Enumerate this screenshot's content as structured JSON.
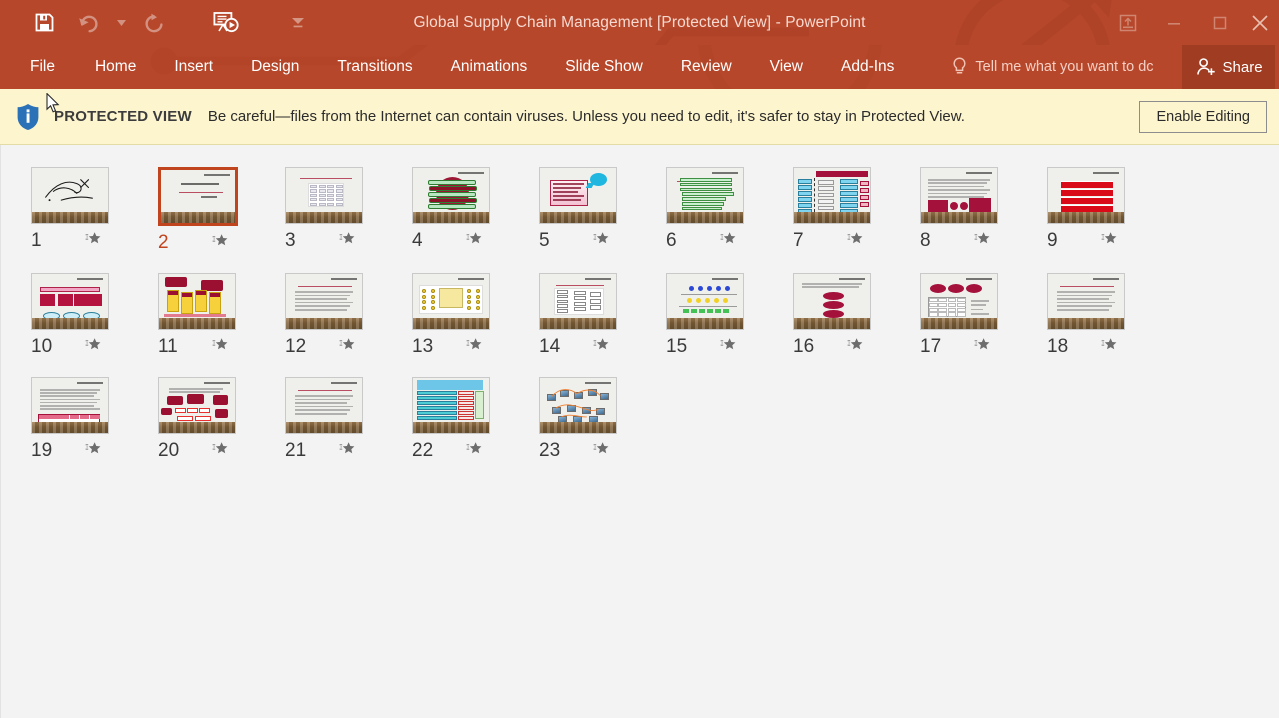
{
  "window": {
    "title": "Global Supply Chain Management [Protected View] - PowerPoint",
    "minimize_label": "Minimize",
    "restore_label": "Restore Down",
    "close_label": "Close",
    "ribbon_display_label": "Ribbon Display Options"
  },
  "quick_access": {
    "save_label": "Save",
    "undo_label": "Undo",
    "undo_dropdown_label": "Undo options",
    "redo_label": "Repeat",
    "present_label": "Start From Beginning",
    "customize_label": "Customize Quick Access Toolbar"
  },
  "ribbon": {
    "tabs": [
      {
        "label": "File"
      },
      {
        "label": "Home"
      },
      {
        "label": "Insert"
      },
      {
        "label": "Design"
      },
      {
        "label": "Transitions"
      },
      {
        "label": "Animations"
      },
      {
        "label": "Slide Show"
      },
      {
        "label": "Review"
      },
      {
        "label": "View"
      },
      {
        "label": "Add-Ins"
      }
    ],
    "tell_me_placeholder": "Tell me what you want to dc",
    "share_label": "Share"
  },
  "protected_view": {
    "label": "PROTECTED VIEW",
    "message": "Be careful—files from the Internet can contain viruses. Unless you need to edit, it's safer to stay in Protected View.",
    "button_label": "Enable Editing"
  },
  "slides": [
    {
      "number": "1",
      "selected": false,
      "kind": "calligraphy"
    },
    {
      "number": "2",
      "selected": true,
      "kind": "title"
    },
    {
      "number": "3",
      "selected": false,
      "kind": "grid-table"
    },
    {
      "number": "4",
      "selected": false,
      "kind": "circle-bars-green"
    },
    {
      "number": "5",
      "selected": false,
      "kind": "callout-pink"
    },
    {
      "number": "6",
      "selected": false,
      "kind": "green-stack"
    },
    {
      "number": "7",
      "selected": false,
      "kind": "flow-blue-red"
    },
    {
      "number": "8",
      "selected": false,
      "kind": "text-crimson-shapes"
    },
    {
      "number": "9",
      "selected": false,
      "kind": "red-stack"
    },
    {
      "number": "10",
      "selected": false,
      "kind": "pink-boxes-ovals"
    },
    {
      "number": "11",
      "selected": false,
      "kind": "yellow-crimson-chart"
    },
    {
      "number": "12",
      "selected": false,
      "kind": "text-only"
    },
    {
      "number": "13",
      "selected": false,
      "kind": "yellow-network"
    },
    {
      "number": "14",
      "selected": false,
      "kind": "flowchart-doc"
    },
    {
      "number": "15",
      "selected": false,
      "kind": "layered-network"
    },
    {
      "number": "16",
      "selected": false,
      "kind": "three-ellipses"
    },
    {
      "number": "17",
      "selected": false,
      "kind": "ellipses-table"
    },
    {
      "number": "18",
      "selected": false,
      "kind": "text-only"
    },
    {
      "number": "19",
      "selected": false,
      "kind": "text-crimson-table"
    },
    {
      "number": "20",
      "selected": false,
      "kind": "crimson-orgchart"
    },
    {
      "number": "21",
      "selected": false,
      "kind": "text-only"
    },
    {
      "number": "22",
      "selected": false,
      "kind": "teal-table"
    },
    {
      "number": "23",
      "selected": false,
      "kind": "photo-network"
    }
  ],
  "colors": {
    "titlebar": "#b7472a",
    "share_button": "#a03c21",
    "protected_view_bar": "#fdf5ce",
    "selection": "#c0451f",
    "pane_background": "#f3f3f3",
    "info_icon": "#2b71b8"
  }
}
